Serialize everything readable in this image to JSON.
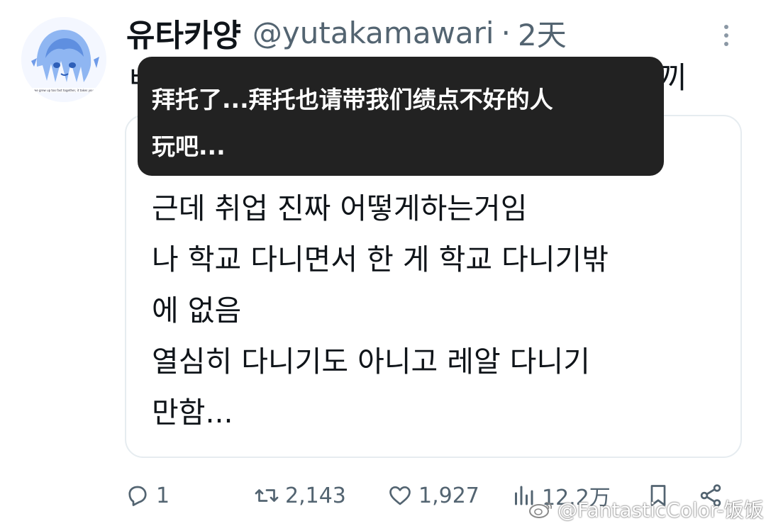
{
  "author": {
    "display_name": "유타카양",
    "handle": "@yutakamawari",
    "separator": "·",
    "time": "2天",
    "avatar_caption": "we grew up too fast together, it takes you"
  },
  "tweet": {
    "text_left_fragment": "ㅂ",
    "text_right_fragment": "끼"
  },
  "quote": {
    "lines": [
      "근데 취업 진짜 어떻게하는거임",
      "나 학교 다니면서 한 게 학교 다니기밖",
      "에 없음",
      "열심히 다니기도 아니고 레알 다니기",
      "만함..."
    ]
  },
  "translation": {
    "lines": [
      "拜托了...拜托也请带我们绩点不好的人",
      "玩吧..."
    ]
  },
  "actions": {
    "reply_count": "1",
    "retweet_count": "2,143",
    "like_count": "1,927",
    "views_count": "12.2万"
  },
  "watermark": {
    "text": "@FantasticColor-饭饭"
  },
  "colors": {
    "text": "#0f1419",
    "secondary": "#536471",
    "overlay": "#222222",
    "border": "#e6ecf0"
  },
  "icons": [
    "more-icon",
    "reply-icon",
    "retweet-icon",
    "like-icon",
    "views-icon",
    "bookmark-icon",
    "share-icon",
    "weibo-icon"
  ]
}
